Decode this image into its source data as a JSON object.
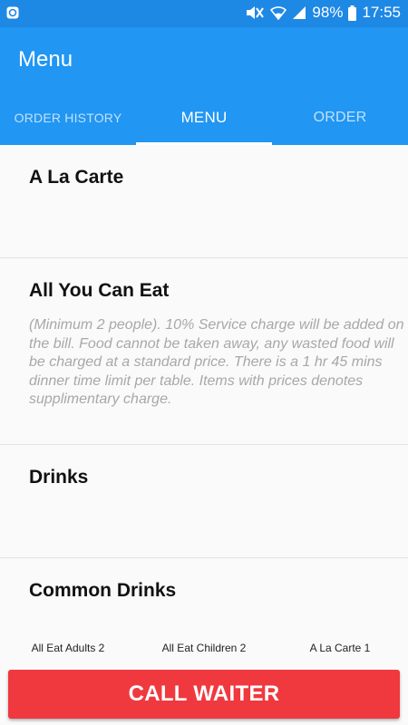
{
  "status_bar": {
    "left_icon": "notification-app-icon",
    "icons": [
      "mute-icon",
      "wifi-icon",
      "signal-icon"
    ],
    "battery": "98%",
    "battery_icon": "battery-icon",
    "time": "17:55"
  },
  "app_bar": {
    "title": "Menu"
  },
  "tabs": [
    {
      "label": "ORDER HISTORY",
      "active": false
    },
    {
      "label": "MENU",
      "active": true
    },
    {
      "label": "ORDER",
      "active": false
    }
  ],
  "sections": [
    {
      "title": "A La Carte",
      "description": ""
    },
    {
      "title": "All You Can Eat",
      "description": "(Minimum 2 people). 10% Service charge will be added on the bill. Food cannot be taken away, any wasted food will be charged at a standard price. There is a 1 hr 45 mins dinner time limit per table. Items with prices denotes supplimentary charge."
    },
    {
      "title": "Drinks",
      "description": ""
    },
    {
      "title": "Common Drinks",
      "description": ""
    }
  ],
  "order_tabs": [
    "All Eat Adults 2",
    "All Eat Children 2",
    "A La Carte 1"
  ],
  "call_button": {
    "label": "CALL WAITER"
  },
  "colors": {
    "status_bar": "#1e88e5",
    "app_bar": "#2196f3",
    "call_button": "#f0393f"
  }
}
